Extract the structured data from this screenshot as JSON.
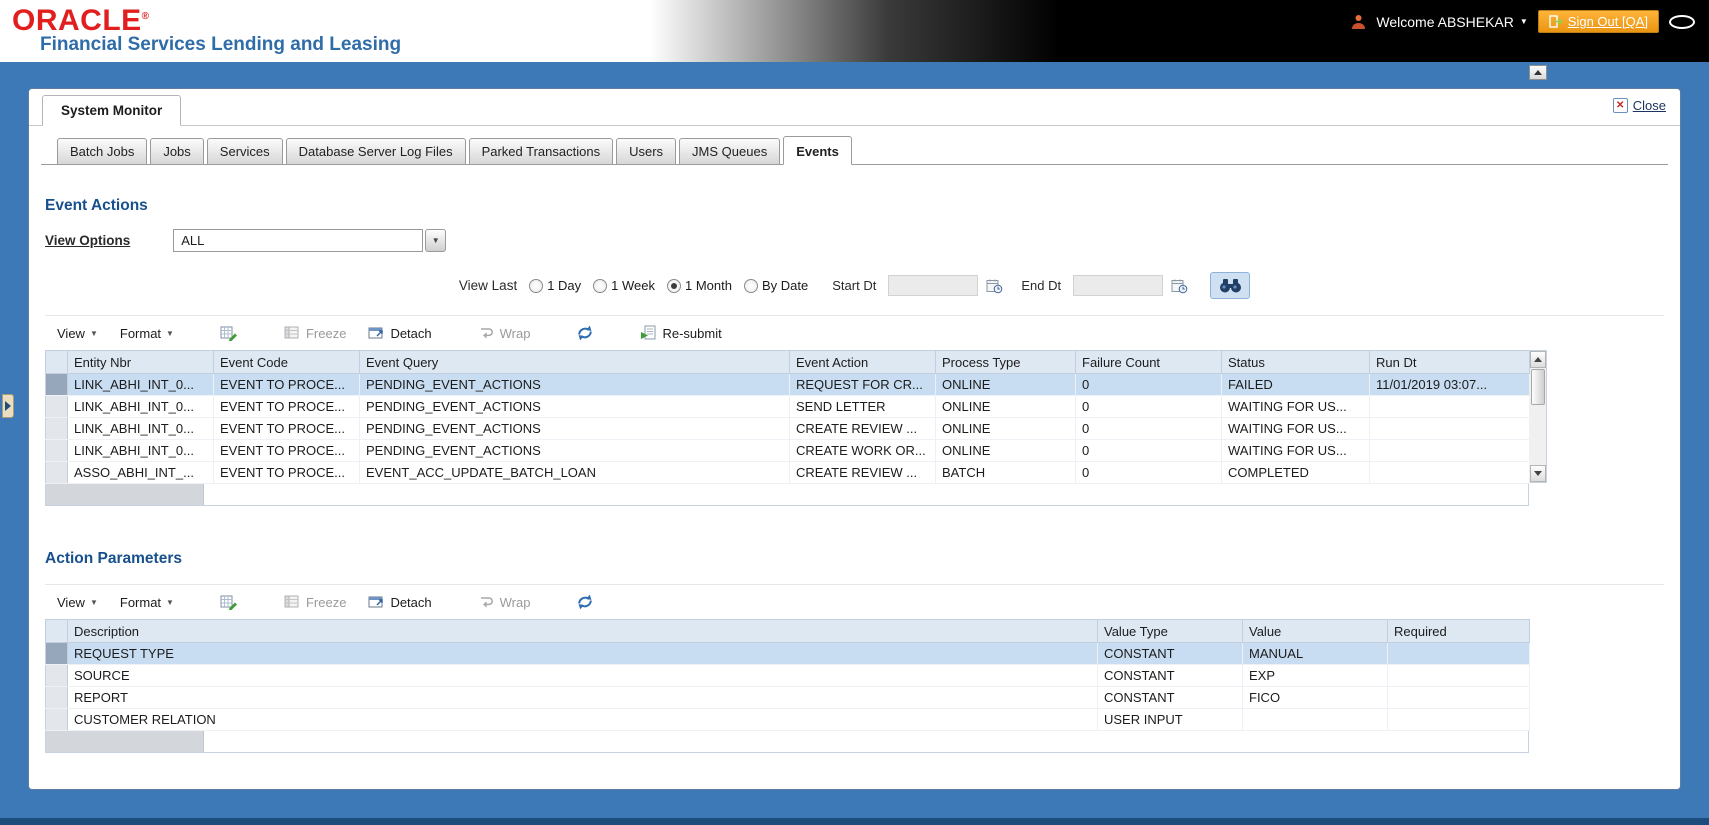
{
  "header": {
    "brand_name": "ORACLE",
    "brand_reg": "®",
    "brand_subtitle": "Financial Services Lending and Leasing",
    "welcome": "Welcome ABSHEKAR",
    "sign_out": "Sign Out [QA]"
  },
  "window": {
    "title": "System Monitor",
    "close_label": "Close"
  },
  "tabs": {
    "items": [
      {
        "label": "Batch Jobs",
        "active": false
      },
      {
        "label": "Jobs",
        "active": false
      },
      {
        "label": "Services",
        "active": false
      },
      {
        "label": "Database Server Log Files",
        "active": false
      },
      {
        "label": "Parked Transactions",
        "active": false
      },
      {
        "label": "Users",
        "active": false
      },
      {
        "label": "JMS Queues",
        "active": false
      },
      {
        "label": "Events",
        "active": true
      }
    ]
  },
  "event_actions": {
    "title": "Event Actions",
    "view_options": {
      "label": "View Options",
      "value": "ALL"
    },
    "filter": {
      "view_last_label": "View Last",
      "options": [
        {
          "label": "1 Day",
          "selected": false
        },
        {
          "label": "1 Week",
          "selected": false
        },
        {
          "label": "1 Month",
          "selected": true
        },
        {
          "label": "By Date",
          "selected": false
        }
      ],
      "start_dt_label": "Start Dt",
      "start_dt_value": "",
      "end_dt_label": "End Dt",
      "end_dt_value": ""
    },
    "toolbar": {
      "view": "View",
      "format": "Format",
      "freeze": "Freeze",
      "detach": "Detach",
      "wrap": "Wrap",
      "resubmit": "Re-submit"
    },
    "table": {
      "columns": [
        "Entity Nbr",
        "Event Code",
        "Event Query",
        "Event Action",
        "Process Type",
        "Failure Count",
        "Status",
        "Run Dt"
      ],
      "rows": [
        {
          "entity_nbr": "LINK_ABHI_INT_0...",
          "event_code": "EVENT TO PROCE...",
          "event_query": "PENDING_EVENT_ACTIONS",
          "event_action": "REQUEST FOR CR...",
          "process_type": "ONLINE",
          "failure_count": "0",
          "status": "FAILED",
          "run_dt": "11/01/2019 03:07...",
          "selected": true
        },
        {
          "entity_nbr": "LINK_ABHI_INT_0...",
          "event_code": "EVENT TO PROCE...",
          "event_query": "PENDING_EVENT_ACTIONS",
          "event_action": "SEND LETTER",
          "process_type": "ONLINE",
          "failure_count": "0",
          "status": "WAITING FOR US...",
          "run_dt": "",
          "selected": false
        },
        {
          "entity_nbr": "LINK_ABHI_INT_0...",
          "event_code": "EVENT TO PROCE...",
          "event_query": "PENDING_EVENT_ACTIONS",
          "event_action": "CREATE REVIEW ...",
          "process_type": "ONLINE",
          "failure_count": "0",
          "status": "WAITING FOR US...",
          "run_dt": "",
          "selected": false
        },
        {
          "entity_nbr": "LINK_ABHI_INT_0...",
          "event_code": "EVENT TO PROCE...",
          "event_query": "PENDING_EVENT_ACTIONS",
          "event_action": "CREATE WORK OR...",
          "process_type": "ONLINE",
          "failure_count": "0",
          "status": "WAITING FOR US...",
          "run_dt": "",
          "selected": false
        },
        {
          "entity_nbr": "ASSO_ABHI_INT_...",
          "event_code": "EVENT TO PROCE...",
          "event_query": "EVENT_ACC_UPDATE_BATCH_LOAN",
          "event_action": "CREATE REVIEW ...",
          "process_type": "BATCH",
          "failure_count": "0",
          "status": "COMPLETED",
          "run_dt": "",
          "selected": false
        }
      ]
    }
  },
  "action_parameters": {
    "title": "Action Parameters",
    "toolbar": {
      "view": "View",
      "format": "Format",
      "freeze": "Freeze",
      "detach": "Detach",
      "wrap": "Wrap"
    },
    "table": {
      "columns": [
        "Description",
        "Value Type",
        "Value",
        "Required"
      ],
      "rows": [
        {
          "description": "REQUEST TYPE",
          "value_type": "CONSTANT",
          "value": "MANUAL",
          "required": "",
          "selected": true
        },
        {
          "description": "SOURCE",
          "value_type": "CONSTANT",
          "value": "EXP",
          "required": "",
          "selected": false
        },
        {
          "description": "REPORT",
          "value_type": "CONSTANT",
          "value": "FICO",
          "required": "",
          "selected": false
        },
        {
          "description": "CUSTOMER RELATION",
          "value_type": "USER INPUT",
          "value": "",
          "required": "",
          "selected": false
        }
      ]
    }
  }
}
